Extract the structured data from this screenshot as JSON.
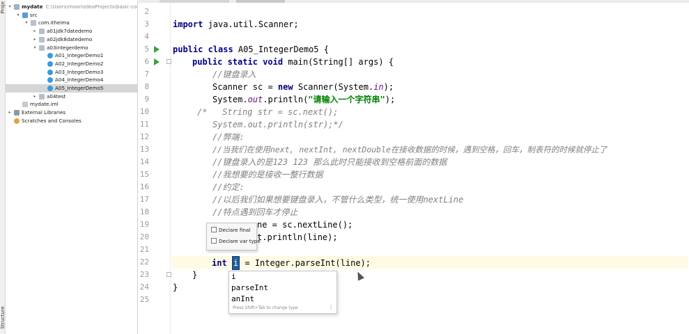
{
  "toolstrip": {
    "project_label": "Proje",
    "structure_label": "Structure"
  },
  "project_tree": {
    "items": [
      {
        "label": "mydate",
        "hint": "C:\\Users\\moon\\IdeaProjects\\basic-code",
        "icon": "module-folder-icon",
        "arrow": "down",
        "bold": true,
        "indent": 0
      },
      {
        "label": "src",
        "icon": "source-folder-icon",
        "arrow": "down",
        "indent": 1
      },
      {
        "label": "com.itheima",
        "icon": "package-icon",
        "arrow": "down",
        "indent": 2
      },
      {
        "label": "a01jdk7datedemo",
        "icon": "package-icon",
        "arrow": "right",
        "indent": 3
      },
      {
        "label": "a02jdk8datedemo",
        "icon": "package-icon",
        "arrow": "right",
        "indent": 3
      },
      {
        "label": "a03integerdemo",
        "icon": "package-icon",
        "arrow": "down",
        "indent": 3
      },
      {
        "label": "A01_IntegerDemo1",
        "icon": "java-class-icon",
        "arrow": "",
        "indent": 4
      },
      {
        "label": "A02_IntegerDemo2",
        "icon": "java-class-icon",
        "arrow": "",
        "indent": 4
      },
      {
        "label": "A03_IntegerDemo3",
        "icon": "java-class-icon",
        "arrow": "",
        "indent": 4
      },
      {
        "label": "A04_IntegerDemo4",
        "icon": "java-class-icon",
        "arrow": "",
        "indent": 4
      },
      {
        "label": "A05_IntegerDemo5",
        "icon": "java-class-icon",
        "arrow": "",
        "indent": 4,
        "selected": true
      },
      {
        "label": "a04test",
        "icon": "package-icon",
        "arrow": "right",
        "indent": 3
      },
      {
        "label": "mydate.iml",
        "icon": "iml-file-icon",
        "arrow": "",
        "indent": 1
      },
      {
        "label": "External Libraries",
        "icon": "library-icon",
        "arrow": "right",
        "indent": 0
      },
      {
        "label": "Scratches and Consoles",
        "icon": "scratch-icon",
        "arrow": "",
        "indent": 0
      }
    ]
  },
  "editor": {
    "line_numbers": [
      "2",
      "3",
      "4",
      "5",
      "6",
      "7",
      "8",
      "9",
      "10",
      "11",
      "12",
      "13",
      "14",
      "15",
      "16",
      "17",
      "18",
      "19",
      "20",
      "21",
      "22",
      "23",
      "24",
      "25"
    ],
    "run_markers": [
      "5",
      "6"
    ],
    "fold_markers": [
      "6",
      "23"
    ],
    "current_line": "22",
    "code": {
      "l3_kw": "import",
      "l3_rest": " java.util.Scanner;",
      "l5_kw": "public class",
      "l5_rest": " A05_IntegerDemo5 {",
      "l6_kw": "public static void",
      "l6_rest": " main(String[] args) {",
      "l7": "//键盘录入",
      "l8_a": "Scanner sc = ",
      "l8_kw": "new",
      "l8_b": " Scanner(System.",
      "l8_fld": "in",
      "l8_c": ");",
      "l9_a": "System.",
      "l9_fld": "out",
      "l9_b": ".println(",
      "l9_str": "\"请输入一个字符串\"",
      "l9_c": ");",
      "l10": "/*   String str = sc.next();",
      "l11": "System.out.println(str);*/",
      "l12": "//弊端:",
      "l13": "//当我们在使用next, nextInt, nextDouble在接收数据的时候，遇到空格，回车，制表符的时候就停止了",
      "l14": "//键盘录入的是123 123 那么此时只能接收到空格前面的数据",
      "l15": "//我想要的是接收一整行数据",
      "l16": "//约定:",
      "l17": "//以后我们如果想要键盘录入，不管什么类型，统一使用nextLine",
      "l18": "//特点遇到回车才停止",
      "l19_tail": "ne = sc.nextLine();",
      "l20_tail": "t.println(line);",
      "l22_kw": "int",
      "l22_var": "i",
      "l22_rest": " = Integer.parseInt(line);",
      "l23": "}",
      "l24": "}"
    }
  },
  "intention_popup": {
    "items": [
      "Declare final",
      "Declare var type"
    ]
  },
  "completion_popup": {
    "items": [
      "i",
      "parseInt",
      "anInt"
    ],
    "footer": "Press Shift+Tab to change type",
    "more_glyph": "⋮"
  }
}
